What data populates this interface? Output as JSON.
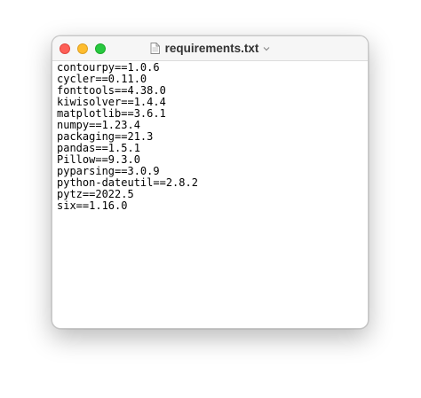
{
  "window": {
    "title": "requirements.txt",
    "icons": {
      "close": "close-button",
      "minimize": "minimize-button",
      "maximize": "maximize-button",
      "document": "document-icon",
      "title_menu": "chevron-down-icon"
    },
    "colors": {
      "close": "#fe5f57",
      "minimize": "#febc2e",
      "maximize": "#28c840"
    }
  },
  "document": {
    "lines": [
      "contourpy==1.0.6",
      "cycler==0.11.0",
      "fonttools==4.38.0",
      "kiwisolver==1.4.4",
      "matplotlib==3.6.1",
      "numpy==1.23.4",
      "packaging==21.3",
      "pandas==1.5.1",
      "Pillow==9.3.0",
      "pyparsing==3.0.9",
      "python-dateutil==2.8.2",
      "pytz==2022.5",
      "six==1.16.0"
    ]
  }
}
